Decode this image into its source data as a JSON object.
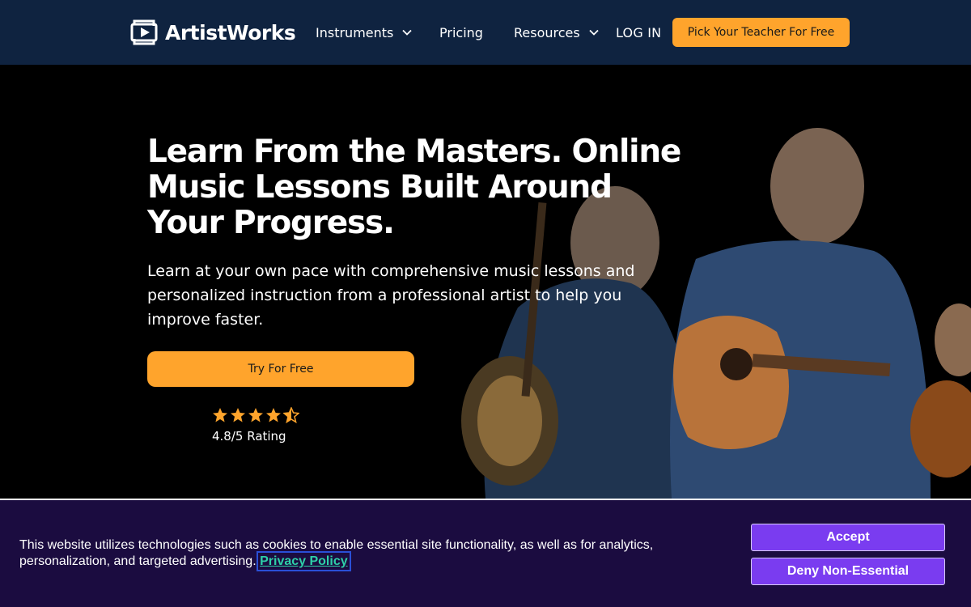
{
  "brand": {
    "name": "ArtistWorks",
    "icon": "play-logo-icon"
  },
  "nav": {
    "instruments": "Instruments",
    "pricing": "Pricing",
    "resources": "Resources",
    "login": "LOG IN",
    "cta": "Pick Your Teacher For Free"
  },
  "hero": {
    "title": "Learn From the Masters. Online Music Lessons Built Around Your Progress.",
    "subtitle": "Learn at your own pace with comprehensive music lessons and personalized instruction from a professional artist to help you improve faster.",
    "cta": "Try For Free",
    "rating_value": 4.5,
    "rating_text": "4.8/5 Rating"
  },
  "cookie": {
    "text": "This website utilizes technologies such as cookies to enable essential site functionality, as well as for analytics, personalization, and targeted advertising.",
    "link": "Privacy Policy",
    "accept": "Accept",
    "deny": "Deny Non-Essential"
  },
  "colors": {
    "nav_bg": "#0f2340",
    "accent": "#ffa42c",
    "cookie_bg": "#1b0c40",
    "cookie_button": "#7a3cf0",
    "link": "#2ed0a8"
  }
}
